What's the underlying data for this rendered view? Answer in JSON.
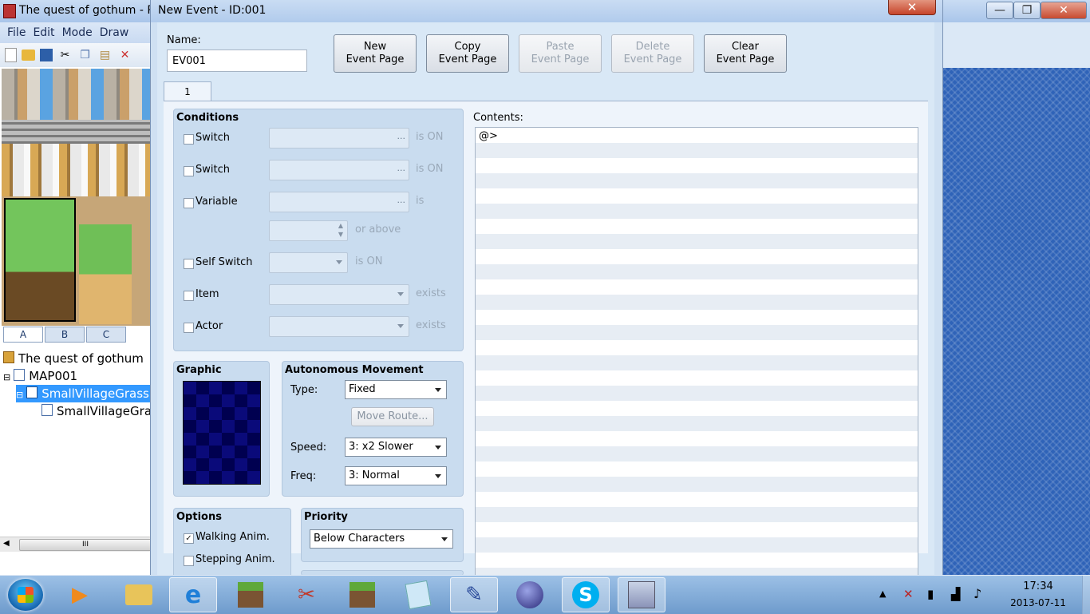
{
  "main_window": {
    "title": "The quest of gothum - R",
    "menu": [
      "File",
      "Edit",
      "Mode",
      "Draw"
    ],
    "tileset_tabs": [
      "A",
      "B",
      "C"
    ],
    "tree": {
      "project": "The quest of gothum",
      "map": "MAP001",
      "selected": "SmallVillageGrass",
      "child": "SmallVillageGras"
    },
    "scroll_grip": "III",
    "buttons": {
      "minimize": "—",
      "maximize": "❐",
      "close": "✕"
    }
  },
  "dialog": {
    "title": "New Event - ID:001",
    "close": "✕",
    "name_label": "Name:",
    "name_value": "EV001",
    "buttons": {
      "new_page": [
        "New",
        "Event Page"
      ],
      "copy_page": [
        "Copy",
        "Event Page"
      ],
      "paste_page": [
        "Paste",
        "Event Page"
      ],
      "delete_page": [
        "Delete",
        "Event Page"
      ],
      "clear_page": [
        "Clear",
        "Event Page"
      ]
    },
    "page_tab": "1",
    "conditions": {
      "title": "Conditions",
      "switch1": "Switch",
      "switch2": "Switch",
      "variable": "Variable",
      "self_switch": "Self Switch",
      "item": "Item",
      "actor": "Actor",
      "is_on": "is ON",
      "is": "is",
      "or_above": "or above",
      "exists": "exists",
      "dots": "..."
    },
    "graphic": {
      "title": "Graphic"
    },
    "autonomous": {
      "title": "Autonomous Movement",
      "type_label": "Type:",
      "type_value": "Fixed",
      "move_route": "Move Route...",
      "speed_label": "Speed:",
      "speed_value": "3: x2 Slower",
      "freq_label": "Freq:",
      "freq_value": "3: Normal"
    },
    "options": {
      "title": "Options",
      "walking": "Walking Anim.",
      "walking_checked": true,
      "stepping": "Stepping Anim.",
      "check_mark": "✓"
    },
    "priority": {
      "title": "Priority",
      "value": "Below Characters"
    },
    "contents": {
      "label": "Contents:",
      "first_line": "@>"
    }
  },
  "taskbar": {
    "time": "17:34",
    "date": "2013-07-11"
  }
}
